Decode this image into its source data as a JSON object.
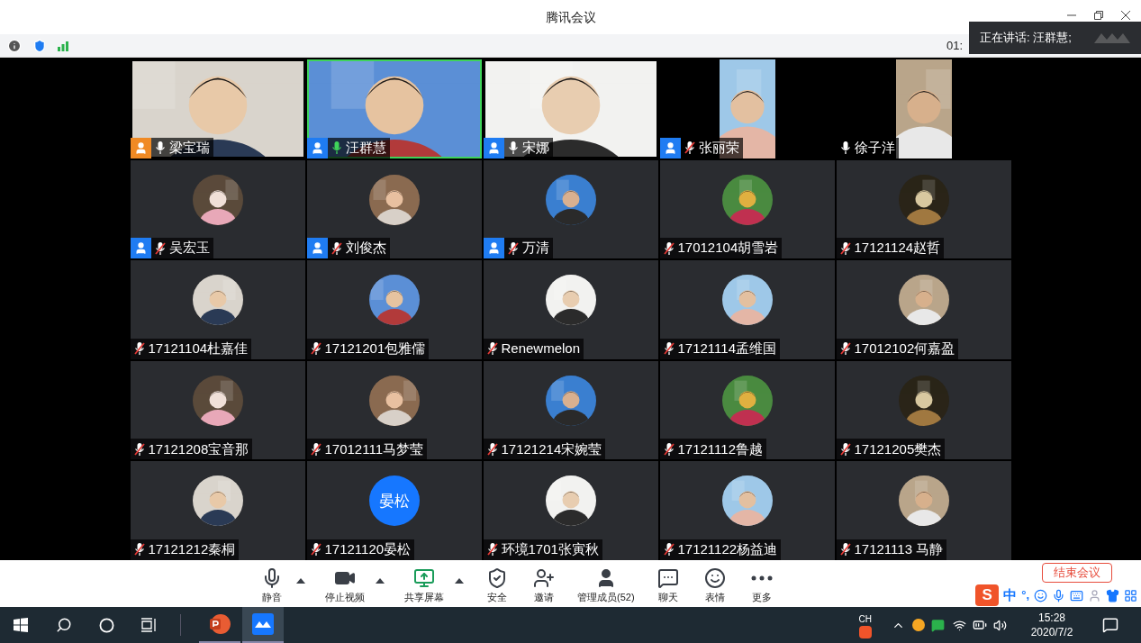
{
  "window": {
    "title": "腾讯会议"
  },
  "info_bar": {
    "timer": "01:"
  },
  "speaker_toast": {
    "text": "正在讲话: 汪群慧;"
  },
  "tiles": [
    {
      "kind": "video",
      "name": "梁宝瑞",
      "color": "#f08a24",
      "muted": false,
      "speaking": false,
      "selected": false
    },
    {
      "kind": "video",
      "name": "汪群慧",
      "color": "#1f7cf2",
      "muted": false,
      "speaking": true,
      "selected": true
    },
    {
      "kind": "video",
      "name": "宋娜",
      "color": "#1f7cf2",
      "muted": false,
      "speaking": false,
      "selected": false
    },
    {
      "kind": "portrait",
      "name": "张丽荣",
      "color": "#1f7cf2",
      "muted": true,
      "speaking": false,
      "selected": false
    },
    {
      "kind": "portrait",
      "name": "徐子洋",
      "muted": false,
      "speaking": false,
      "selected": false
    },
    {
      "kind": "avatar",
      "name": "吴宏玉",
      "color": "#1f7cf2",
      "muted": true,
      "speaking": false,
      "selected": false
    },
    {
      "kind": "avatar",
      "name": "刘俊杰",
      "color": "#1f7cf2",
      "muted": true,
      "speaking": false,
      "selected": false
    },
    {
      "kind": "avatar",
      "name": "万清",
      "color": "#1f7cf2",
      "muted": true,
      "speaking": false,
      "selected": false
    },
    {
      "kind": "avatar",
      "name": "17012104胡雪岩",
      "muted": true,
      "speaking": false,
      "selected": false
    },
    {
      "kind": "avatar",
      "name": "17121124赵哲",
      "muted": true,
      "speaking": false,
      "selected": false
    },
    {
      "kind": "avatar",
      "name": "17121104杜嘉佳",
      "muted": true,
      "speaking": false,
      "selected": false
    },
    {
      "kind": "avatar",
      "name": "17121201包雅儒",
      "muted": true,
      "speaking": false,
      "selected": false
    },
    {
      "kind": "avatar",
      "name": "Renewmelon",
      "muted": true,
      "speaking": false,
      "selected": false
    },
    {
      "kind": "avatar",
      "name": "17121114孟维国",
      "muted": true,
      "speaking": false,
      "selected": false
    },
    {
      "kind": "avatar",
      "name": "17012102何嘉盈",
      "muted": true,
      "speaking": false,
      "selected": false
    },
    {
      "kind": "avatar",
      "name": "17121208宝音那",
      "muted": true,
      "speaking": false,
      "selected": false
    },
    {
      "kind": "avatar",
      "name": "17012111马梦莹",
      "muted": true,
      "speaking": false,
      "selected": false
    },
    {
      "kind": "avatar",
      "name": "17121214宋婉莹",
      "muted": true,
      "speaking": false,
      "selected": false
    },
    {
      "kind": "avatar",
      "name": "17121112鲁越",
      "muted": true,
      "speaking": false,
      "selected": false
    },
    {
      "kind": "avatar",
      "name": "17121205樊杰",
      "muted": true,
      "speaking": false,
      "selected": false
    },
    {
      "kind": "avatar",
      "name": "17121212秦桐",
      "muted": true,
      "speaking": false,
      "selected": false
    },
    {
      "kind": "text_avatar",
      "name": "17121120晏松",
      "avatar_text": "晏松",
      "muted": true,
      "speaking": false,
      "selected": false
    },
    {
      "kind": "avatar",
      "name": "环境1701张寅秋",
      "muted": true,
      "speaking": false,
      "selected": false
    },
    {
      "kind": "avatar",
      "name": "17121122杨益迪",
      "muted": true,
      "speaking": false,
      "selected": false
    },
    {
      "kind": "avatar",
      "name": "17121113 马静",
      "muted": true,
      "speaking": false,
      "selected": false
    }
  ],
  "toolbar": [
    {
      "kind": "mic",
      "label": "静音",
      "menu": true
    },
    {
      "kind": "video",
      "label": "停止视频",
      "menu": true
    },
    {
      "kind": "share",
      "label": "共享屏幕",
      "menu": true
    },
    {
      "kind": "security",
      "label": "安全",
      "menu": false
    },
    {
      "kind": "invite",
      "label": "邀请",
      "menu": false
    },
    {
      "kind": "members",
      "label": "管理成员(52)",
      "menu": false
    },
    {
      "kind": "chat",
      "label": "聊天",
      "menu": false
    },
    {
      "kind": "emoji",
      "label": "表情",
      "menu": false
    },
    {
      "kind": "more",
      "label": "更多",
      "menu": false
    }
  ],
  "end_button": {
    "label": "结束会议"
  },
  "ime_bar": {
    "logo": "S",
    "mode": "中",
    "punct": "°,"
  },
  "taskbar": {
    "language": "CH",
    "time": "15:28",
    "date": "2020/7/2"
  }
}
